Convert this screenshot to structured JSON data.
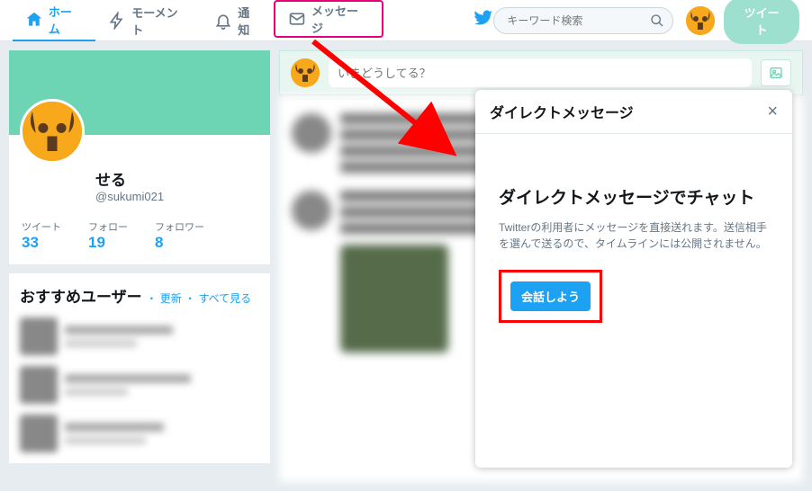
{
  "nav": {
    "home": "ホーム",
    "moments": "モーメント",
    "notifications": "通知",
    "messages": "メッセージ"
  },
  "search": {
    "placeholder": "キーワード検索"
  },
  "tweet_button": "ツイート",
  "profile": {
    "name": "せる",
    "handle": "@sukumi021",
    "stats": {
      "tweets_label": "ツイート",
      "tweets": "33",
      "following_label": "フォロー",
      "following": "19",
      "followers_label": "フォロワー",
      "followers": "8"
    }
  },
  "suggest": {
    "title": "おすすめユーザー",
    "refresh": "更新",
    "separator": "・",
    "view_all": "すべて見る"
  },
  "compose": {
    "placeholder": "いまどうしてる？"
  },
  "dm": {
    "header": "ダイレクトメッセージ",
    "title": "ダイレクトメッセージでチャット",
    "desc": "Twitterの利用者にメッセージを直接送れます。送信相手を選んで送るので、タイムラインには公開されません。",
    "cta": "会話しよう"
  },
  "colors": {
    "accent": "#1da1f2",
    "highlight_pink": "#e6007e",
    "highlight_red": "#ff0000"
  }
}
